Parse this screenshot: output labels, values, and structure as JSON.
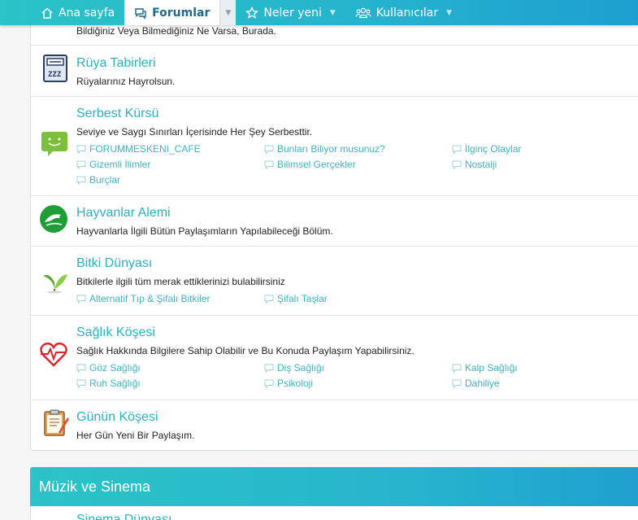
{
  "nav": {
    "items": [
      {
        "label": "Ana sayfa",
        "icon": "home-icon",
        "active": false
      },
      {
        "label": "Forumlar",
        "icon": "chat-icon",
        "active": true
      },
      {
        "label": "Neler yeni",
        "icon": "star-icon",
        "active": false
      },
      {
        "label": "Kullanıcılar",
        "icon": "users-icon",
        "active": false
      }
    ]
  },
  "nodes": {
    "top": {
      "desc": "Bildiğiniz Veya Bilmediğiniz Ne Varsa, Burada."
    },
    "ruya": {
      "title": "Rüya Tabirleri",
      "desc": "Rüyalarınız Hayrolsun.",
      "icon": "zzz-book-icon"
    },
    "serbest": {
      "title": "Serbest Kürsü",
      "desc": "Seviye ve Saygı Sınırları İçerisinde Her Şey Serbesttir.",
      "icon": "speech-bubble-icon",
      "subs": [
        "FORUMMESKENI_CAFE",
        "Bunları Biliyor musunuz?",
        "İlginç Olaylar",
        "Gizemli İlimler",
        "Bilimsel Gerçekler",
        "Nostalji",
        "Burçlar"
      ]
    },
    "hayvan": {
      "title": "Hayvanlar Alemi",
      "desc": "Hayvanlarla İlgili Bütün Paylaşımların Yapılabileceği Bölüm.",
      "icon": "dolphin-icon"
    },
    "bitki": {
      "title": "Bitki Dünyası",
      "desc": "Bitkilerle ilgili tüm merak ettiklerinizi bulabilirsiniz",
      "icon": "leaf-icon",
      "subs": [
        "Alternatif Tıp & Şifalı Bitkiler",
        "Şifalı Taşlar"
      ]
    },
    "saglik": {
      "title": "Sağlık Köşesi",
      "desc": "Sağlık Hakkında Bilgilere Sahip Olabilir ve Bu Konuda Paylaşım Yapabilirsiniz.",
      "icon": "heartbeat-icon",
      "subs": [
        "Göz Sağlığı",
        "Diş Sağlığı",
        "Kalp Sağlığı",
        "Ruh Sağlığı",
        "Psikoloji",
        "Dahiliye"
      ]
    },
    "gunun": {
      "title": "Günün Köşesi",
      "desc": "Her Gün Yeni Bir Paylaşım.",
      "icon": "clipboard-icon"
    }
  },
  "category": {
    "title": "Müzik ve Sinema",
    "next_title": "Sinema Dünyası"
  },
  "colors": {
    "accent": "#2cb1bd",
    "nav_start": "#2bc3c7",
    "nav_end": "#1e9fd0"
  }
}
